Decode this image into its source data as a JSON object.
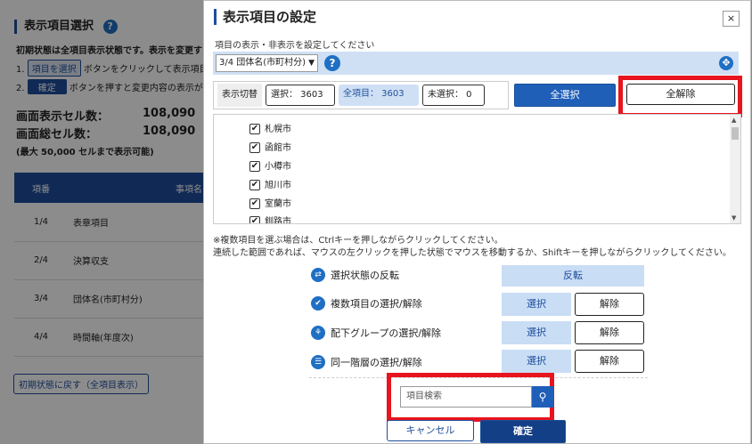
{
  "background": {
    "title": "表示項目選択",
    "intro": "初期状態は全項目表示状態です。表示を変更す",
    "step1_num": "1.",
    "step1_btn": "項目を選択",
    "step1_text": "ボタンをクリックして表示項目",
    "step2_num": "2.",
    "step2_btn": "確定",
    "step2_text": "ボタンを押すと変更内容の表示が",
    "display_cells_label": "画面表示セル数：",
    "display_cells_value": "108,090",
    "total_cells_label": "画面総セル数：",
    "total_cells_value": "108,090",
    "max_note": "(最大 50,000 セルまで表示可能)",
    "table_headers": [
      "項番",
      "事項名"
    ],
    "rows": [
      {
        "num": "1/4",
        "name": "表章項目"
      },
      {
        "num": "2/4",
        "name": "決算収支"
      },
      {
        "num": "3/4",
        "name": "団体名(市町村分)"
      },
      {
        "num": "4/4",
        "name": "時間軸(年度次)"
      }
    ],
    "reset_label": "初期状態に戻す（全項目表示）"
  },
  "dialog": {
    "title": "表示項目の設定",
    "close_label": "×",
    "subtitle": "項目の表示・非表示を設定してください",
    "select_value": "3/4 団体名(市町村分)",
    "help_glyph": "?",
    "switch_label": "表示切替",
    "selected_count": "選択：  3603",
    "all_count": "全項目：  3603",
    "unselected_count": "未選択：  0",
    "select_all_label": "全選択",
    "clear_all_label": "全解除",
    "items": [
      "札幌市",
      "函館市",
      "小樽市",
      "旭川市",
      "室蘭市",
      "釧路市"
    ],
    "note1": "※複数項目を選ぶ場合は、Ctrlキーを押しながらクリックしてください。",
    "note2": "連続した範囲であれば、マウスの左クリックを押した状態でマウスを移動するか、Shiftキーを押しながらクリックしてください。",
    "actions": [
      {
        "label": "選択状態の反転",
        "btn1": "反転"
      },
      {
        "label": "複数項目の選択/解除",
        "btn1": "選択",
        "btn2": "解除"
      },
      {
        "label": "配下グループの選択/解除",
        "btn1": "選択",
        "btn2": "解除"
      },
      {
        "label": "同一階層の選択/解除",
        "btn1": "選択",
        "btn2": "解除"
      }
    ],
    "search_placeholder": "項目検索",
    "cancel_label": "キャンセル",
    "confirm_label": "確定"
  },
  "colors": {
    "accent": "#1f5fb8",
    "highlight_red": "#e8141e",
    "soft_blue": "#cfe0f4"
  }
}
